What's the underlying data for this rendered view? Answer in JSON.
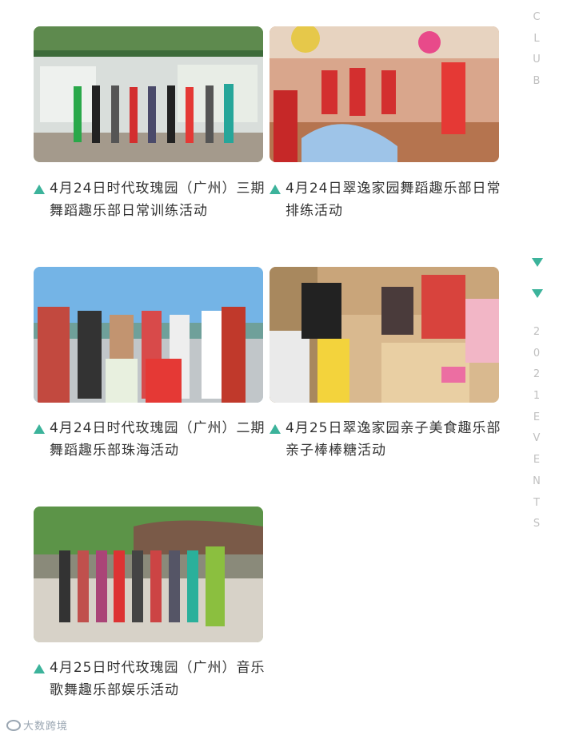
{
  "events": [
    {
      "caption": "4月24日时代玫瑰园（广州）三期舞蹈趣乐部日常训练活动",
      "photo": "group-dancers-outdoor-board"
    },
    {
      "caption": "4月24日翠逸家园舞蹈趣乐部日常排练活动",
      "photo": "fan-dance-rehearsal-red"
    },
    {
      "caption": "4月24日时代玫瑰园（广州）二期舞蹈趣乐部珠海活动",
      "photo": "group-tourists-seaside"
    },
    {
      "caption": "4月25日翠逸家园亲子美食趣乐部亲子棒棒糖活动",
      "photo": "children-making-lollipops"
    },
    {
      "caption": "4月25日时代玫瑰园（广州）音乐歌舞趣乐部娱乐活动",
      "photo": "group-dancers-park-rock"
    }
  ],
  "sidebar": {
    "club_letters": [
      "C",
      "L",
      "U",
      "B"
    ],
    "event_letters": [
      "2",
      "0",
      "2",
      "1",
      "E",
      "V",
      "E",
      "N",
      "T",
      "S"
    ]
  },
  "watermark": "大数跨境",
  "accent_color": "#3cb39b"
}
